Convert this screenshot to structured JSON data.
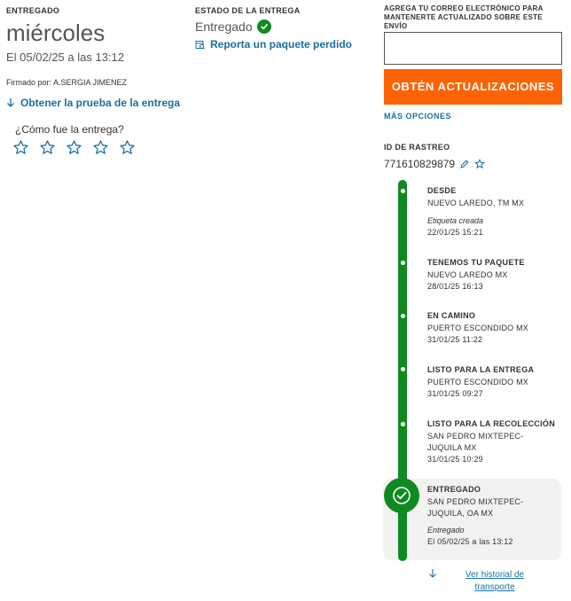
{
  "delivered": {
    "label": "ENTREGADO",
    "day": "miércoles",
    "date_line": "El 05/02/25 a las 13:12",
    "signed_by": "Firmado por: A.SERGIA JIMENEZ",
    "proof_link": "Obtener la prueba de la entrega",
    "rating_question": "¿Cómo fue la entrega?",
    "rating_stars": 5
  },
  "delivery_status": {
    "label": "ESTADO DE LA ENTREGA",
    "value": "Entregado",
    "report_link": "Reporta un paquete perdido"
  },
  "email_updates": {
    "label": "AGREGA TU CORREO ELECTRÓNICO PARA MANTENERTE ACTUALIZADO SOBRE ESTE ENVÍO",
    "input_value": "",
    "button_label": "OBTÉN ACTUALIZACIONES",
    "more_options": "MÁS OPCIONES"
  },
  "tracking": {
    "label": "ID DE RASTREO",
    "id": "771610829879"
  },
  "timeline": [
    {
      "title": "DESDE",
      "location": "NUEVO LAREDO, TM MX",
      "note": "Etiqueta creada",
      "datetime": "22/01/25 15:21"
    },
    {
      "title": "TENEMOS TU PAQUETE",
      "location": "NUEVO LAREDO MX",
      "datetime": "28/01/25 16:13"
    },
    {
      "title": "EN CAMINO",
      "location": "PUERTO ESCONDIDO MX",
      "datetime": "31/01/25 11:22"
    },
    {
      "title": "LISTO PARA LA ENTREGA",
      "location": "PUERTO ESCONDIDO MX",
      "datetime": "31/01/25 09:27"
    },
    {
      "title": "LISTO PARA LA RECOLECCIÓN",
      "location_1": "SAN PEDRO MIXTEPEC-",
      "location_2": "JUQUILA MX",
      "datetime": "31/01/25 10:29"
    },
    {
      "title": "ENTREGADO",
      "location_1": "SAN PEDRO MIXTEPEC-",
      "location_2": "JUQUILA, OA MX",
      "note": "Entregado",
      "datetime": "El 05/02/25 a las 13:12"
    }
  ],
  "history_link": "Ver historial de transporte",
  "colors": {
    "brand_orange": "#ff6200",
    "status_green": "#0f8a21",
    "link_blue": "#1a6fa3"
  }
}
